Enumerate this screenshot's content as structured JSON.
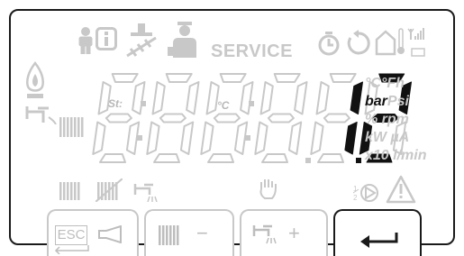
{
  "status": {
    "service_label": "SERVICE"
  },
  "display": {
    "small_left_label": "St:",
    "small_mid_label": "°C",
    "digits": [
      "8",
      "8",
      "8",
      "8",
      "1",
      "2"
    ],
    "active_digits": [
      false,
      false,
      false,
      false,
      true,
      true
    ]
  },
  "units": {
    "line1": "°C°Fh",
    "line2_active": "bar",
    "line2_inactive": "Psi",
    "line3": "% rpm",
    "line4": "kW µA",
    "line5": "x10 l/min"
  },
  "buttons": {
    "esc_label": "ESC",
    "minus_label": "−",
    "plus_label": "+"
  },
  "colors": {
    "inactive": "#c8c8c8",
    "active": "#111111",
    "frame": "#1a1a1a"
  }
}
